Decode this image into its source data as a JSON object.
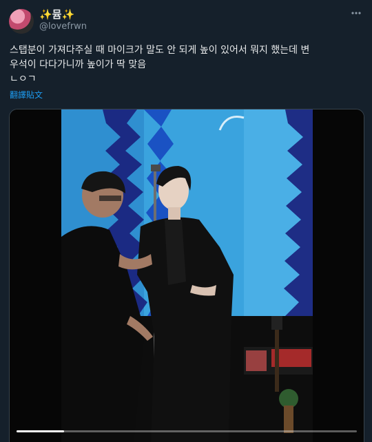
{
  "user": {
    "display_name": "✨뮴✨",
    "handle": "@lovefrwn"
  },
  "tweet": {
    "text": "스탭분이 가져다주실 때 마이크가 말도 안 되게 높이 있어서 뭐지 했는데 변\n우석이 다다가니까 높이가 딱 맞음\nㄴㅇㄱ",
    "translate_label": "翻譯貼文"
  },
  "menu_icon": "more-horizontal-icon",
  "media": {
    "type": "video",
    "progress": 0.14
  },
  "colors": {
    "background": "#15202b",
    "accent": "#1d9bf0",
    "secondary_text": "#8b98a5",
    "stage_screen": "#38a6e0"
  }
}
